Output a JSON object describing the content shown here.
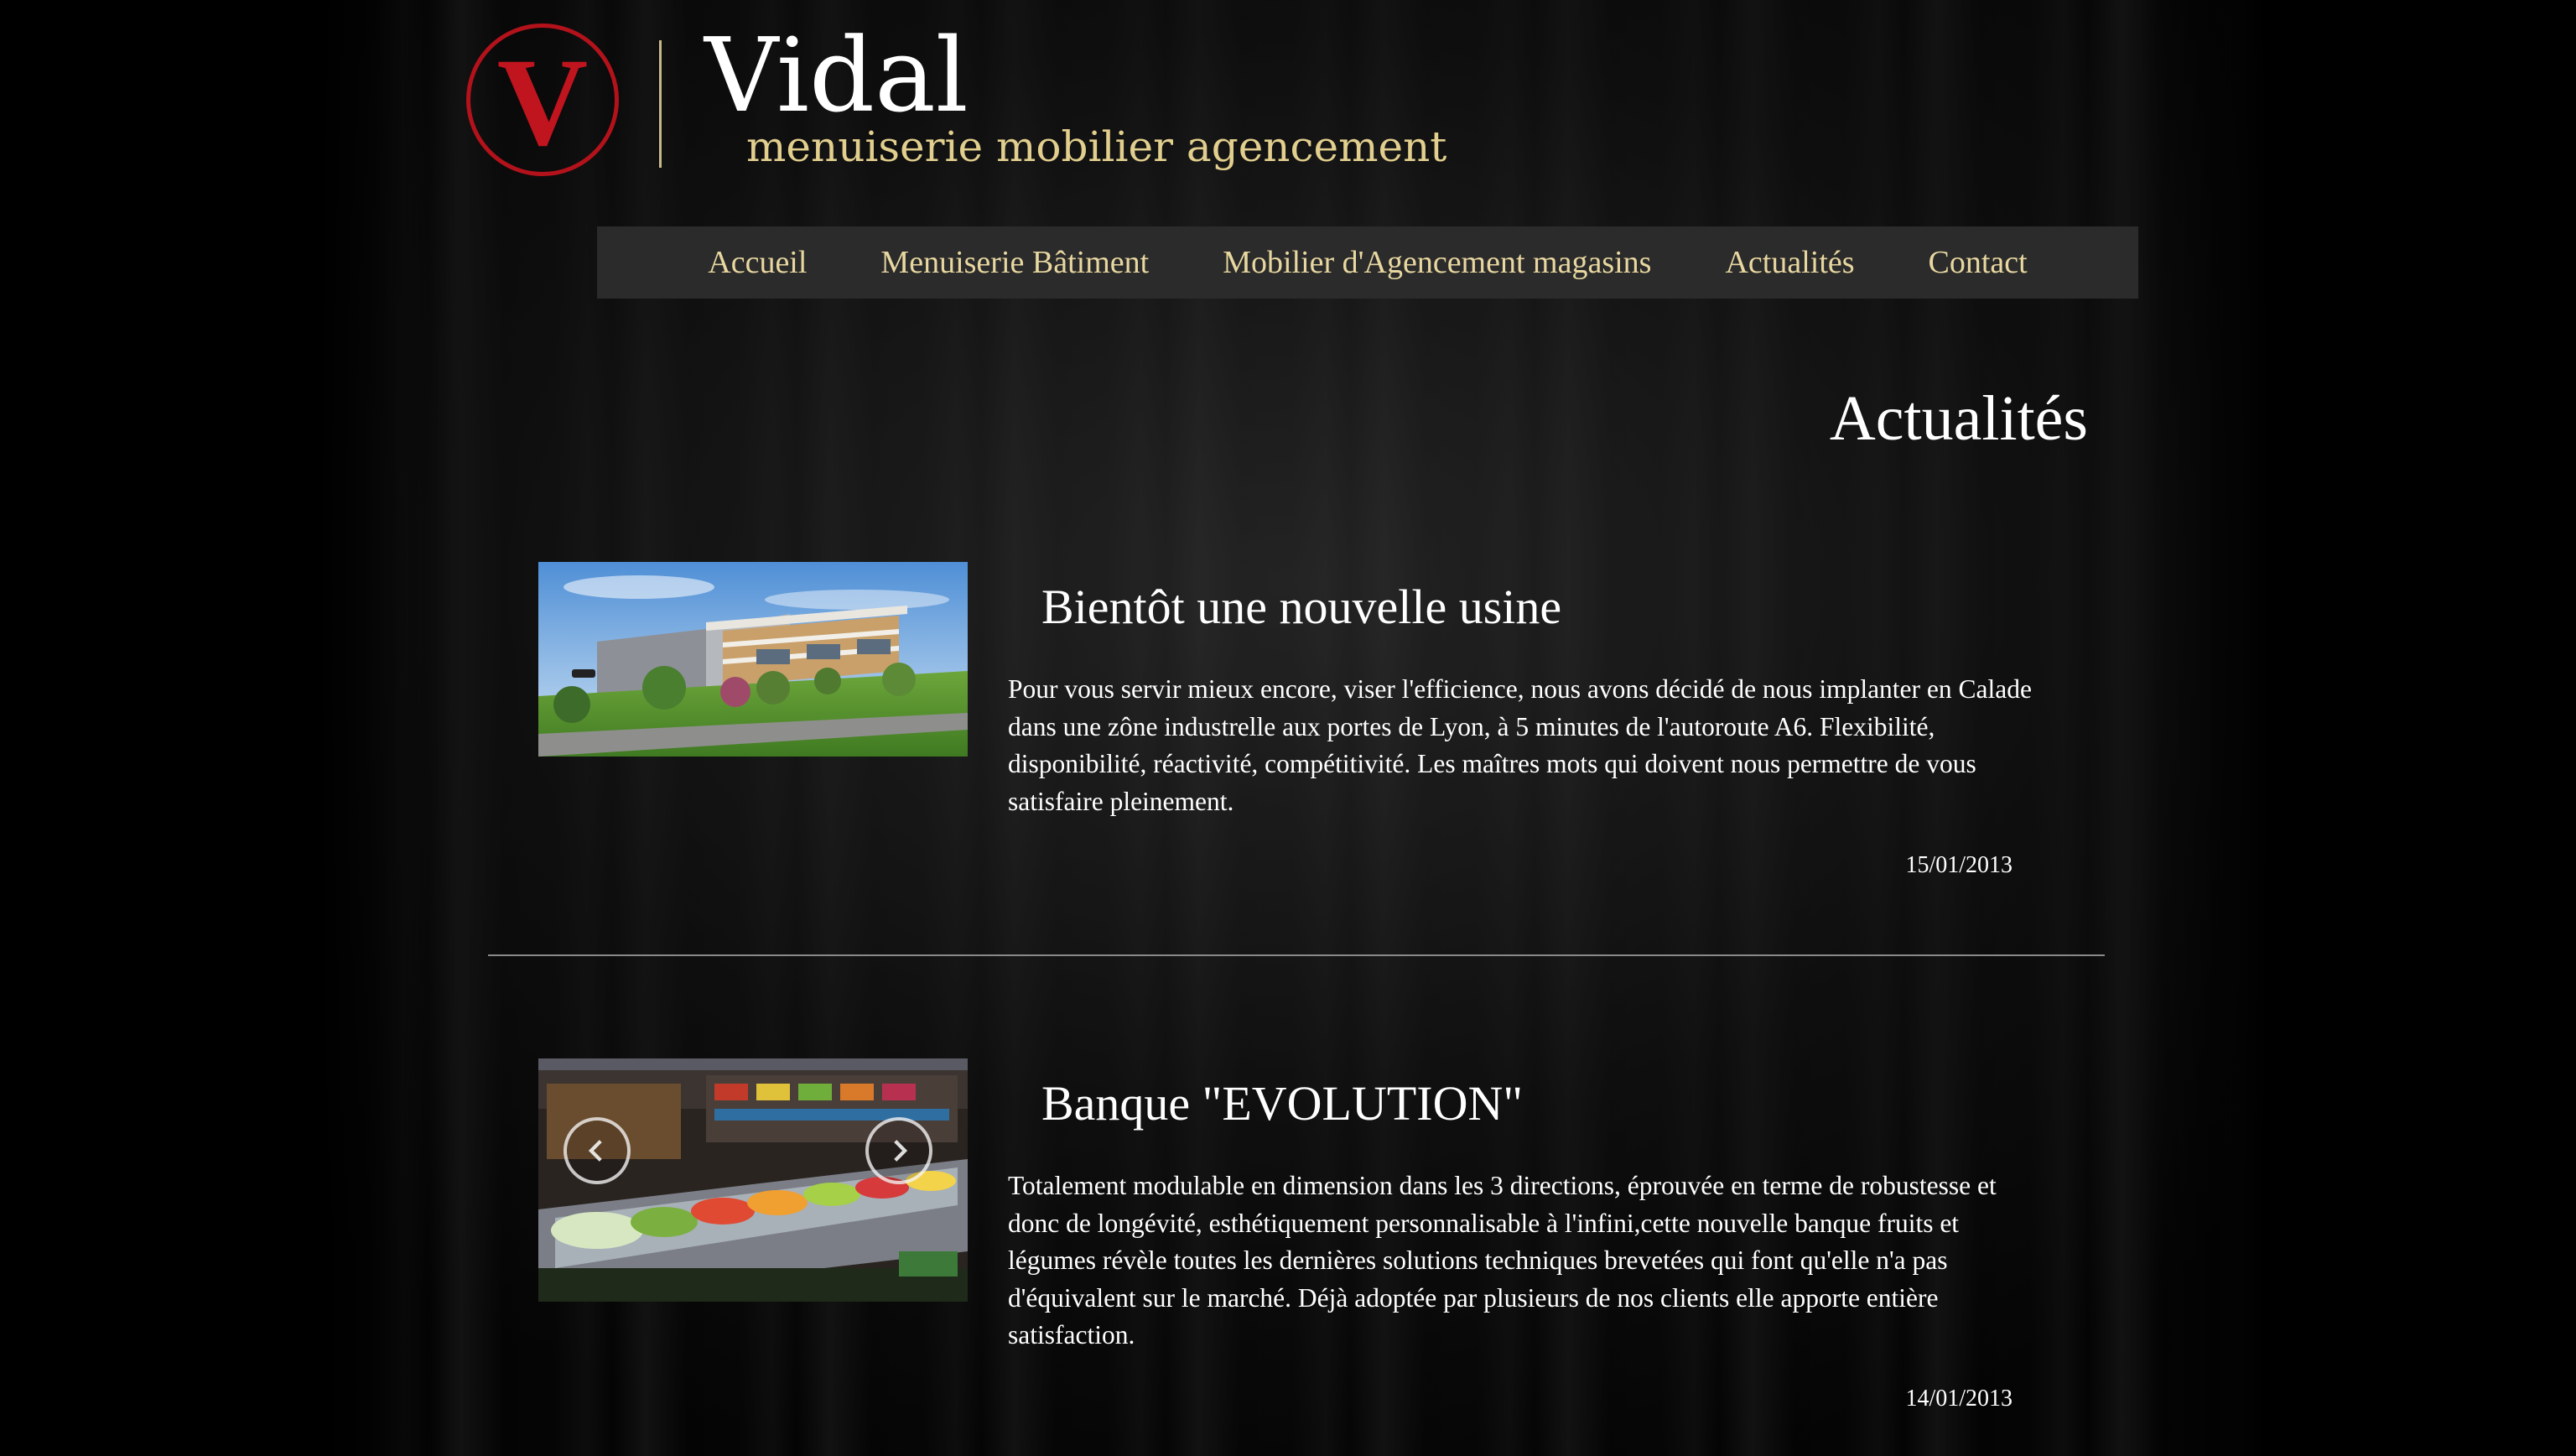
{
  "header": {
    "logo_letter": "V",
    "brand_name": "Vidal",
    "tagline": "menuiserie mobilier agencement"
  },
  "nav": {
    "items": [
      {
        "label": "Accueil"
      },
      {
        "label": "Menuiserie Bâtiment"
      },
      {
        "label": "Mobilier d'Agencement magasins"
      },
      {
        "label": "Actualités"
      },
      {
        "label": "Contact"
      }
    ]
  },
  "main": {
    "title": "Actualités",
    "articles": [
      {
        "title": "Bientôt une nouvelle usine",
        "body": "Pour vous servir mieux encore, viser l'efficience, nous avons décidé de nous implanter en Calade dans une zône industrelle aux portes de Lyon, à 5 minutes de l'autoroute A6. Flexibilité, disponibilité, réactivité, compétitivité. Les maîtres mots qui doivent nous permettre de vous satisfaire pleinement.",
        "date": "15/01/2013",
        "image": "factory-building-rendering"
      },
      {
        "title": "Banque \"EVOLUTION\"",
        "body": "Totalement modulable en dimension dans les 3 directions, éprouvée en terme de robustesse et donc de longévité, esthétiquement personnalisable à l'infini,cette nouvelle banque fruits et légumes révèle toutes les dernières solutions techniques brevetées qui font qu'elle n'a pas d'équivalent sur le marché. Déjà adoptée par plusieurs de nos clients elle apporte entière satisfaction.",
        "date": "14/01/2013",
        "image": "produce-counter-photo"
      }
    ]
  },
  "colors": {
    "logo_red": "#c0141e",
    "nav_text": "#e8d7a0",
    "nav_bg": "#2b2b2b",
    "tagline": "#e2cf8e"
  }
}
